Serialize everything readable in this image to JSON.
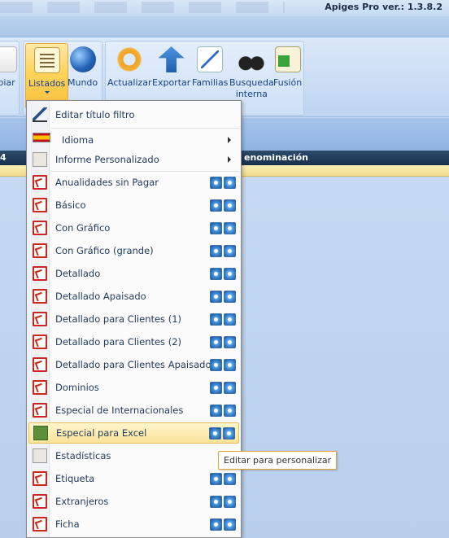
{
  "app": {
    "title": "Apiges Pro ver.: 1.3.8.2"
  },
  "ribbon": {
    "copy_label": "piar",
    "listados_label": "Listados",
    "mundo_label": "Mundo",
    "actualizar_label": "Actualizar",
    "exportar_label": "Exportar",
    "familias_label": "Familias",
    "busqueda_label_1": "Busqueda",
    "busqueda_label_2": "interna",
    "fusion_label": "Fusión"
  },
  "grid": {
    "col1_header": "4",
    "col2_header": "enominación"
  },
  "menu": {
    "edit_filter_title": "Editar título filtro",
    "language": "Idioma",
    "custom_report": "Informe Personalizado",
    "items": [
      {
        "label": "Anualidades sin Pagar",
        "icon": "pdf-icon"
      },
      {
        "label": "Básico",
        "icon": "pdf-icon"
      },
      {
        "label": "Con Gráfico",
        "icon": "pdf-icon"
      },
      {
        "label": "Con Gráfico (grande)",
        "icon": "pdf-icon"
      },
      {
        "label": "Detallado",
        "icon": "pdf-icon"
      },
      {
        "label": "Detallado Apaisado",
        "icon": "pdf-icon"
      },
      {
        "label": "Detallado para Clientes (1)",
        "icon": "pdf-icon"
      },
      {
        "label": "Detallado para Clientes (2)",
        "icon": "pdf-icon"
      },
      {
        "label": "Detallado para Clientes Apaisado",
        "icon": "pdf-icon"
      },
      {
        "label": "Dominios",
        "icon": "pdf-icon"
      },
      {
        "label": "Especial de Internacionales",
        "icon": "pdf-icon"
      },
      {
        "label": "Especial para Excel",
        "icon": "excel-icon",
        "highlighted": true
      },
      {
        "label": "Estadísticas",
        "icon": "clipboard-icon",
        "no_buttons": true
      },
      {
        "label": "Etiqueta",
        "icon": "pdf-icon"
      },
      {
        "label": "Extranjeros",
        "icon": "pdf-icon"
      },
      {
        "label": "Ficha",
        "icon": "pdf-icon"
      }
    ]
  },
  "tooltip": {
    "text": "Editar para personalizar"
  }
}
